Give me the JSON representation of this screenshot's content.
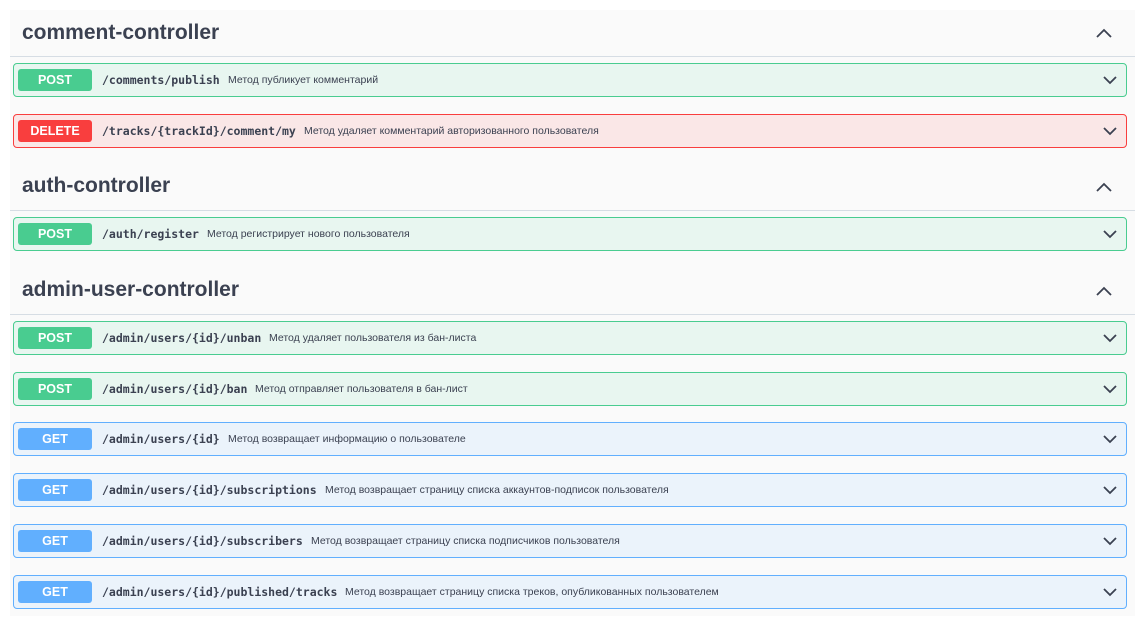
{
  "sections": [
    {
      "title": "comment-controller",
      "operations": [
        {
          "method": "POST",
          "path": "/comments/publish",
          "summary": "Метод публикует комментарий"
        },
        {
          "method": "DELETE",
          "path": "/tracks/{trackId}/comment/my",
          "summary": "Метод удаляет комментарий авторизованного пользователя"
        }
      ]
    },
    {
      "title": "auth-controller",
      "operations": [
        {
          "method": "POST",
          "path": "/auth/register",
          "summary": "Метод регистрирует нового пользователя"
        }
      ]
    },
    {
      "title": "admin-user-controller",
      "operations": [
        {
          "method": "POST",
          "path": "/admin/users/{id}/unban",
          "summary": "Метод удаляет пользователя из бан-листа"
        },
        {
          "method": "POST",
          "path": "/admin/users/{id}/ban",
          "summary": "Метод отправляет пользователя в бан-лист"
        },
        {
          "method": "GET",
          "path": "/admin/users/{id}",
          "summary": "Метод возвращает информацию о пользователе"
        },
        {
          "method": "GET",
          "path": "/admin/users/{id}/subscriptions",
          "summary": "Метод возвращает страницу списка аккаунтов-подписок пользователя"
        },
        {
          "method": "GET",
          "path": "/admin/users/{id}/subscribers",
          "summary": "Метод возвращает страницу списка подписчиков пользователя"
        },
        {
          "method": "GET",
          "path": "/admin/users/{id}/published/tracks",
          "summary": "Метод возвращает страницу списка треков, опубликованных пользователем"
        }
      ]
    }
  ],
  "colors": {
    "post": "#49cc90",
    "delete": "#f93e3e",
    "get": "#61affe",
    "text": "#3b4151"
  },
  "icons": {
    "collapse": "chevron-up-icon",
    "expand": "chevron-down-icon"
  }
}
